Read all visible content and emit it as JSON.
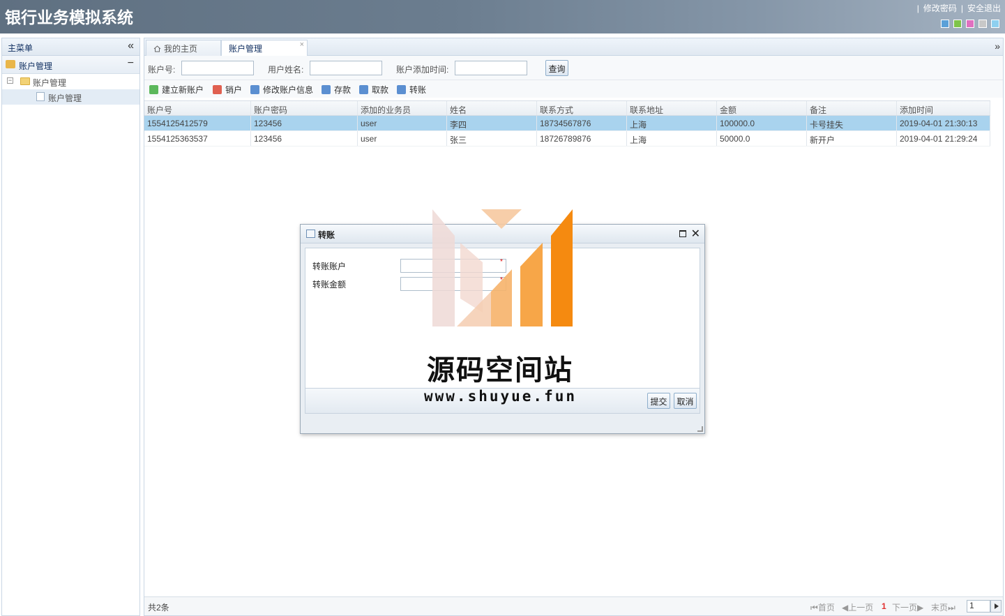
{
  "app": {
    "title": "银行业务模拟系统",
    "links": {
      "change_password": "修改密码",
      "logout": "安全退出"
    },
    "theme_colors": [
      "#5aa0d8",
      "#7ec44a",
      "#e070c0",
      "#c8c8c8",
      "#8ed0f0"
    ]
  },
  "sidebar": {
    "title": "主菜单",
    "collapse_icon": "double-chevron-left-icon",
    "accordion": {
      "label": "账户管理"
    },
    "tree": [
      {
        "label": "账户管理",
        "type": "folder"
      },
      {
        "label": "账户管理",
        "type": "page",
        "selected": true
      }
    ]
  },
  "tabs": [
    {
      "label": "我的主页",
      "icon": "home-icon"
    },
    {
      "label": "账户管理",
      "active": true,
      "closable": true
    }
  ],
  "search": {
    "account_no_label": "账户号:",
    "username_label": "用户姓名:",
    "added_time_label": "账户添加时间:",
    "query_button": "查询"
  },
  "toolbar": [
    {
      "label": "建立新账户",
      "color": "#5cb85c"
    },
    {
      "label": "销户",
      "color": "#e06050"
    },
    {
      "label": "修改账户信息",
      "color": "#5b8fd1"
    },
    {
      "label": "存款",
      "color": "#5b8fd1"
    },
    {
      "label": "取款",
      "color": "#5b8fd1"
    },
    {
      "label": "转账",
      "color": "#5b8fd1"
    }
  ],
  "grid": {
    "columns": [
      "账户号",
      "账户密码",
      "添加的业务员",
      "姓名",
      "联系方式",
      "联系地址",
      "金额",
      "备注",
      "添加时间"
    ],
    "rows": [
      [
        "1554125412579",
        "123456",
        "user",
        "李四",
        "18734567876",
        "上海",
        "100000.0",
        "卡号挂失",
        "2019-04-01 21:30:13"
      ],
      [
        "1554125363537",
        "123456",
        "user",
        "张三",
        "18726789876",
        "上海",
        "50000.0",
        "新开户",
        "2019-04-01 21:29:24"
      ]
    ],
    "selected_row": 0
  },
  "pager": {
    "total": "共2条",
    "first": "首页",
    "prev": "上一页",
    "current": "1",
    "next": "下一页",
    "last": "末页",
    "page_input": "1"
  },
  "dialog": {
    "title": "转账",
    "fields": [
      {
        "label": "转账账户",
        "value": ""
      },
      {
        "label": "转账金额",
        "value": ""
      }
    ],
    "submit": "提交",
    "cancel": "取消"
  },
  "watermark": {
    "title": "源码空间站",
    "url": "www.shuyue.fun"
  }
}
